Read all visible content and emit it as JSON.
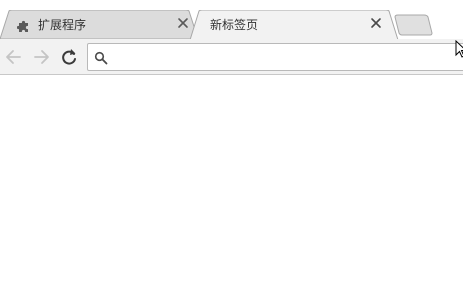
{
  "window": {
    "title": "新标签页"
  },
  "tabs": [
    {
      "label": "扩展程序",
      "icon": "puzzle-piece-icon",
      "active": false,
      "close_icon": "close-icon"
    },
    {
      "label": "新标签页",
      "icon": "",
      "active": true,
      "close_icon": "close-icon"
    }
  ],
  "new_tab": {
    "icon": "new-tab-icon"
  },
  "toolbar": {
    "back_icon": "arrow-left-icon",
    "forward_icon": "arrow-right-icon",
    "reload_icon": "reload-icon"
  },
  "omnibox": {
    "value": "",
    "placeholder": "",
    "icon": "search-icon"
  },
  "colors": {
    "tabstrip_inactive": "#dcdcdc",
    "tab_active": "#f2f2f2",
    "toolbar": "#f2f2f2",
    "border": "#a8a8a8"
  }
}
